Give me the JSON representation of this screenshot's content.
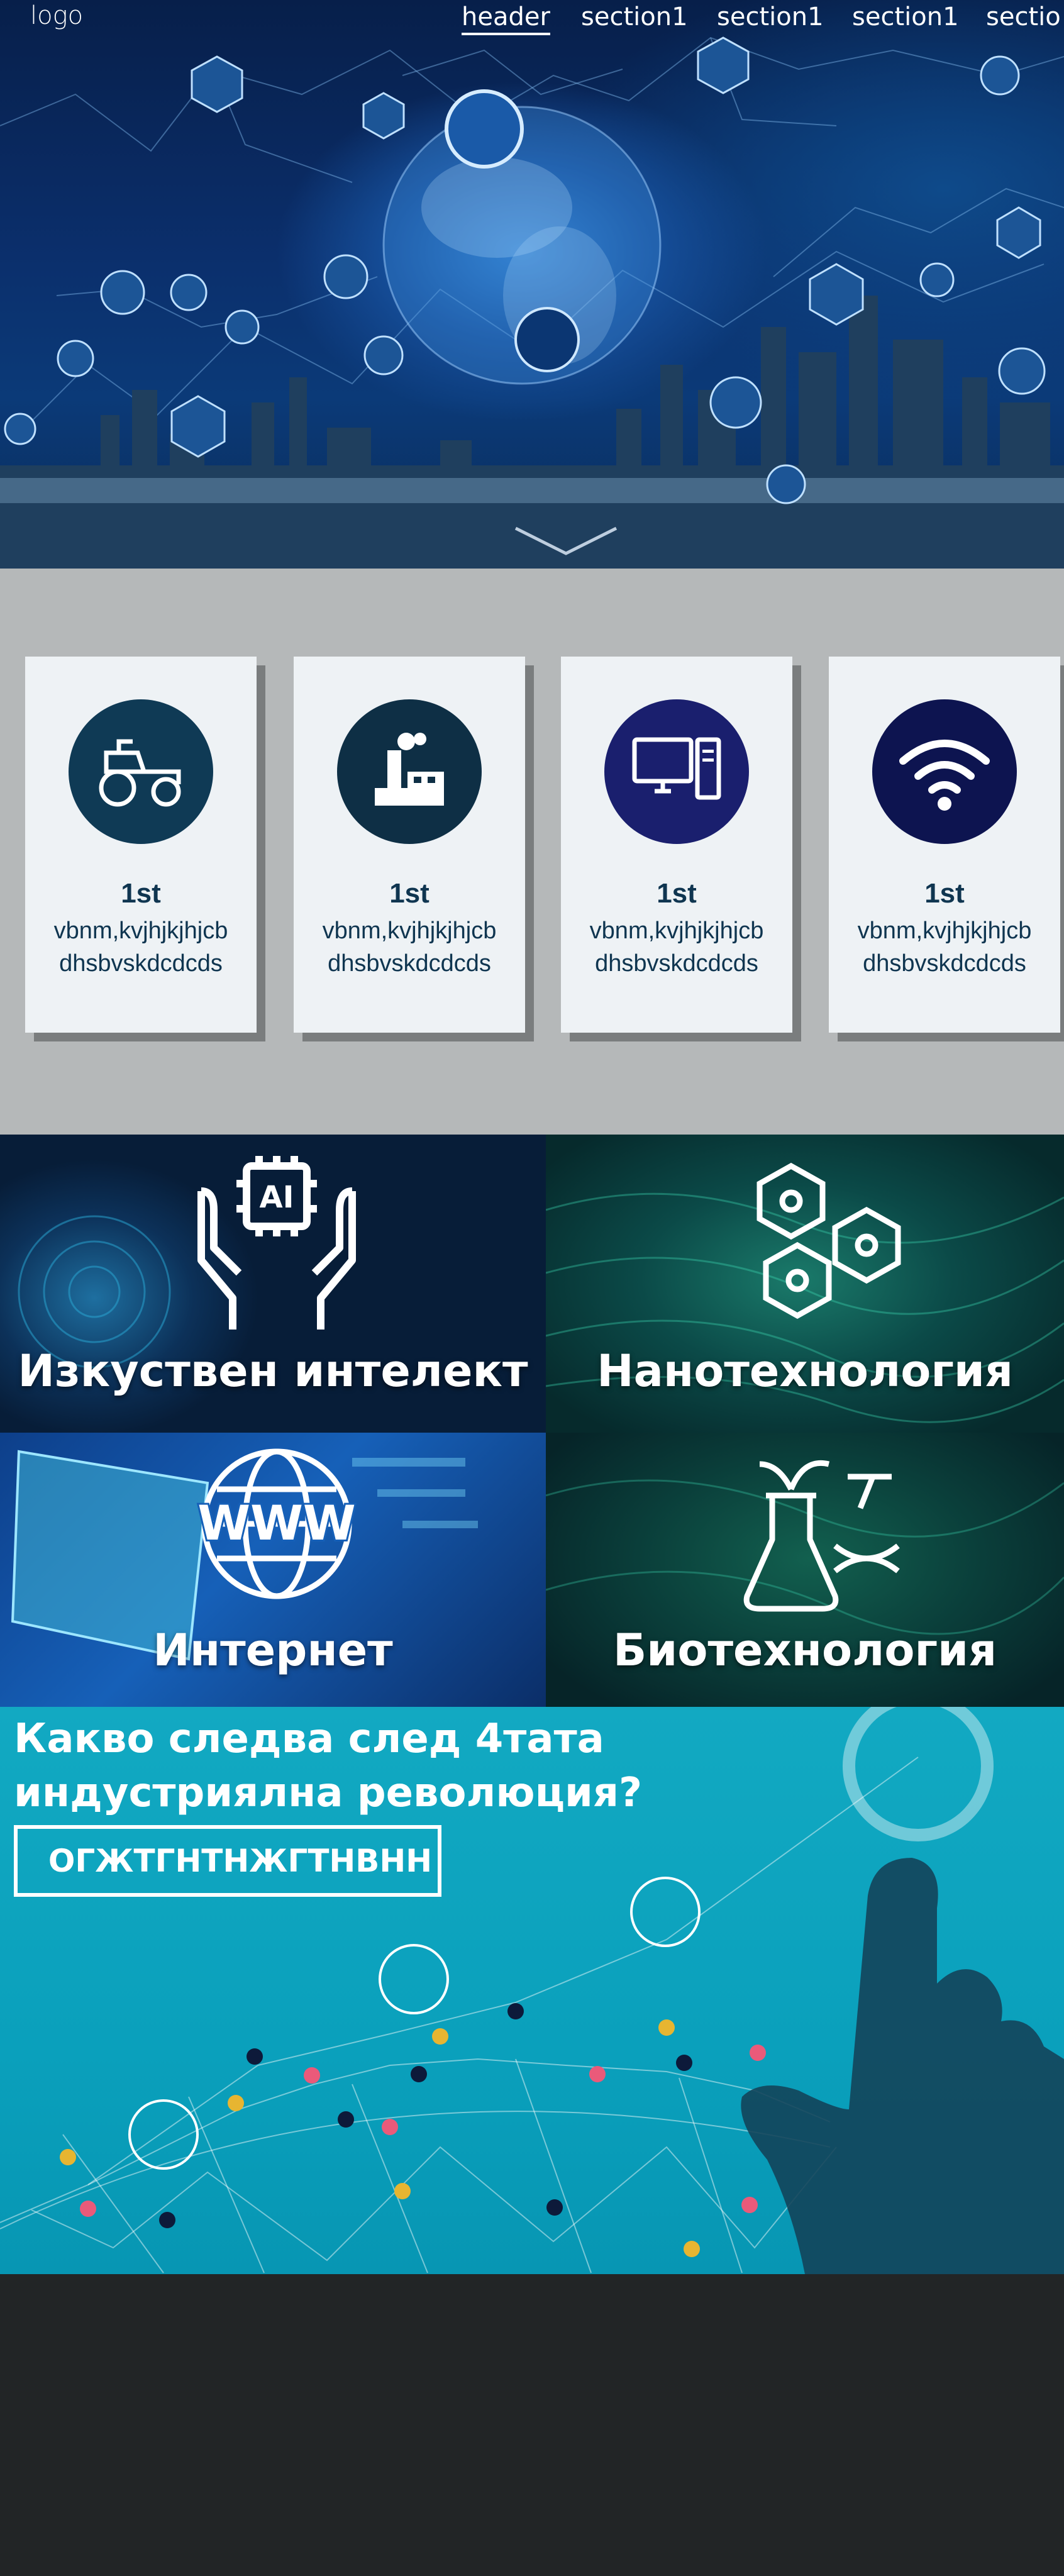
{
  "nav": {
    "logo": "logo",
    "links": [
      "header",
      "section1",
      "section1",
      "section1",
      "sectio"
    ]
  },
  "cards": [
    {
      "title": "1st",
      "line1": "vbnm,kvjhjkjhjcb",
      "line2": "dhsbvskdcdcds",
      "icon": "tractor-icon",
      "color": "#0f3a55"
    },
    {
      "title": "1st",
      "line1": "vbnm,kvjhjkjhjcb",
      "line2": "dhsbvskdcdcds",
      "icon": "factory-icon",
      "color": "#0e2f45"
    },
    {
      "title": "1st",
      "line1": "vbnm,kvjhjkjhjcb",
      "line2": "dhsbvskdcdcds",
      "icon": "desktop-computer-icon",
      "color": "#1a1f6e"
    },
    {
      "title": "1st",
      "line1": "vbnm,kvjhjkjhjcb",
      "line2": "dhsbvskdcdcds",
      "icon": "wifi-icon",
      "color": "#0d1450"
    }
  ],
  "tiles": [
    {
      "label": "Изкуствен интелект",
      "icon": "ai-hands-icon"
    },
    {
      "label": "Нанотехнология",
      "icon": "molecule-hexagon-icon"
    },
    {
      "label": "Интернет",
      "icon": "www-globe-icon"
    },
    {
      "label": "Биотехнология",
      "icon": "flask-dna-icon"
    }
  ],
  "banner": {
    "heading": "Какво следва след 4тата индустриялна революция?",
    "button": "ОГЖТГНТНЖГТНВНН"
  }
}
